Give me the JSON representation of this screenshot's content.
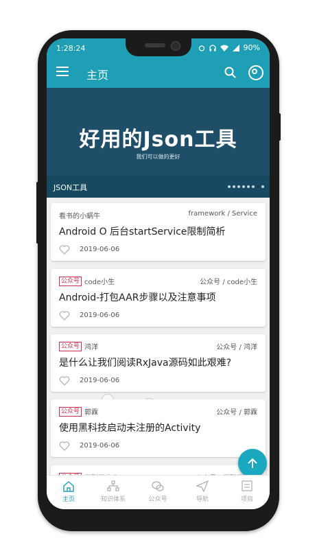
{
  "status": {
    "time": "1:28:24",
    "battery": "90%"
  },
  "toolbar": {
    "title": "主页",
    "icons": [
      "menu-icon",
      "search-icon",
      "target-icon"
    ]
  },
  "banner": {
    "headline": "好用的Json工具",
    "subline": "我们可以做的更好",
    "caption": "JSON工具",
    "dots_total": 8,
    "dots_active": 7
  },
  "articles": [
    {
      "tag": "",
      "author": "看书的小蜗牛",
      "category": "framework / Service",
      "title": "Android O 后台startService限制简析",
      "date": "2019-06-06"
    },
    {
      "tag": "公众号",
      "author": "code小生",
      "category": "公众号 / code小生",
      "title": "Android-打包AAR步骤以及注意事项",
      "date": "2019-06-06"
    },
    {
      "tag": "公众号",
      "author": "鸿洋",
      "category": "公众号 / 鸿洋",
      "title": "是什么让我们阅读RxJava源码如此艰难?",
      "date": "2019-06-06"
    },
    {
      "tag": "公众号",
      "author": "郭霖",
      "category": "公众号 / 郭霖",
      "title": "使用黑科技启动未注册的Activity",
      "date": "2019-06-06"
    },
    {
      "tag": "公众号",
      "author": "互联网侦察",
      "category": "公众号 / 互联网侦察",
      "title": "",
      "date": ""
    }
  ],
  "bottom_nav": [
    {
      "label": "主页",
      "active": true
    },
    {
      "label": "知识体系",
      "active": false
    },
    {
      "label": "公众号",
      "active": false
    },
    {
      "label": "导航",
      "active": false
    },
    {
      "label": "项目",
      "active": false
    }
  ],
  "colors": {
    "primary": "#1f9fb5",
    "banner": "#1f4f68",
    "tag": "#d12d4f",
    "fab": "#1aa7c0"
  }
}
